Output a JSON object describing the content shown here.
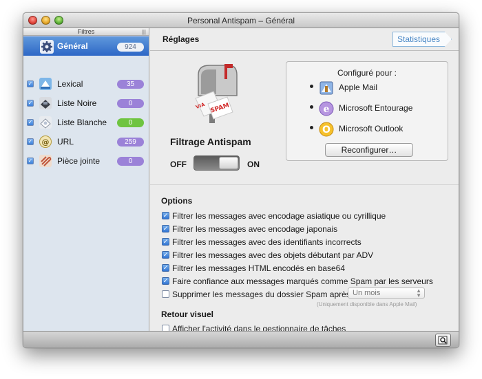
{
  "window": {
    "title": "Personal Antispam – Général"
  },
  "sidebar": {
    "header": "Filtres",
    "selected": {
      "label": "Général",
      "count": "924",
      "icon": "gear-icon"
    },
    "items": [
      {
        "label": "Lexical",
        "count": "35",
        "color": "#9b82d8",
        "icon": "lexical-icon"
      },
      {
        "label": "Liste Noire",
        "count": "0",
        "color": "#9b82d8",
        "icon": "blacklist-icon"
      },
      {
        "label": "Liste Blanche",
        "count": "0",
        "color": "#6fc440",
        "icon": "whitelist-icon"
      },
      {
        "label": "URL",
        "count": "259",
        "color": "#9b82d8",
        "icon": "url-icon"
      },
      {
        "label": "Pièce jointe",
        "count": "0",
        "color": "#9b82d8",
        "icon": "attachment-icon"
      }
    ]
  },
  "main": {
    "title": "Réglages",
    "stats_button": "Statistiques",
    "filter_title": "Filtrage Antispam",
    "toggle_off": "OFF",
    "toggle_on": "ON",
    "toggle_state": "on",
    "configured": {
      "title": "Configuré pour :",
      "clients": [
        "Apple Mail",
        "Microsoft Entourage",
        "Microsoft Outlook"
      ],
      "button": "Reconfigurer…"
    },
    "options": {
      "title": "Options",
      "items": [
        {
          "label": "Filtrer les messages avec encodage asiatique ou cyrillique",
          "checked": true
        },
        {
          "label": "Filtrer les messages avec encodage japonais",
          "checked": true
        },
        {
          "label": "Filtrer les messages avec des identifiants incorrects",
          "checked": true
        },
        {
          "label": "Filtrer les messages avec des objets débutant par ADV",
          "checked": true
        },
        {
          "label": "Filtrer les messages HTML encodés en base64",
          "checked": true
        },
        {
          "label": "Faire confiance aux messages marqués comme Spam par les serveurs",
          "checked": true
        },
        {
          "label": "Supprimer les messages du dossier Spam après",
          "checked": false
        }
      ],
      "select_value": "Un mois",
      "select_note": "(Uniquement disponible dans Apple Mail)"
    },
    "visual": {
      "title": "Retour visuel",
      "item": {
        "label": "Afficher l'activité dans le gestionnaire de tâches",
        "checked": false
      }
    }
  }
}
